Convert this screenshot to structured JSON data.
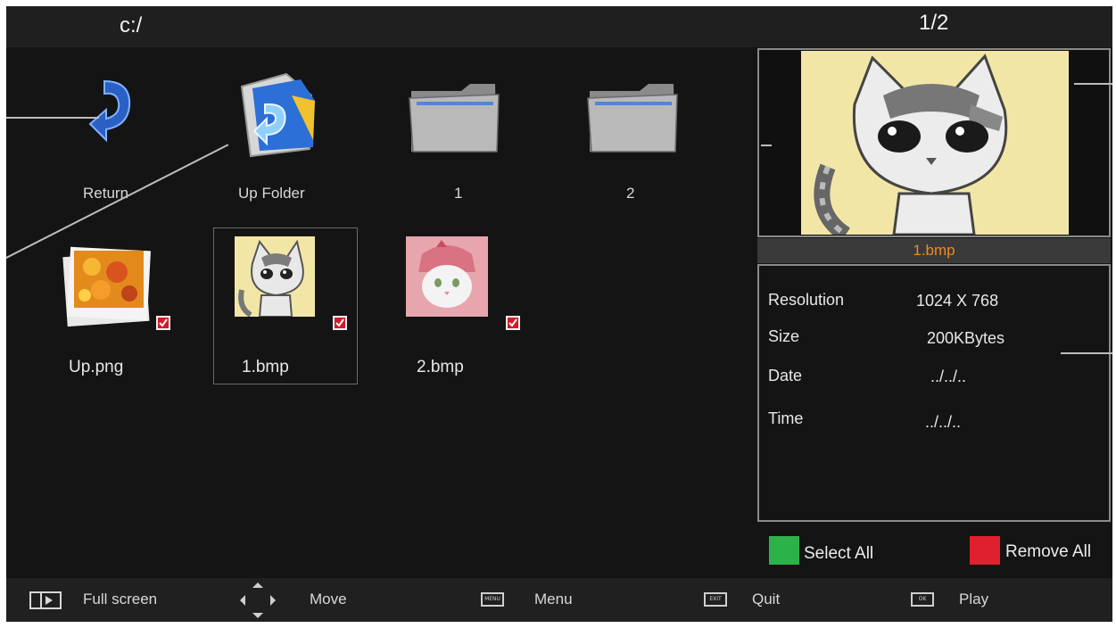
{
  "header": {
    "path": "c:/",
    "page_indicator": "1/2"
  },
  "grid": {
    "items": [
      {
        "label": "Return",
        "icon": "return-arrow-icon"
      },
      {
        "label": "Up Folder",
        "icon": "up-folder-icon"
      },
      {
        "label": "1",
        "icon": "folder-icon"
      },
      {
        "label": "2",
        "icon": "folder-icon"
      },
      {
        "label": "Up.png",
        "icon": "photo-stack-icon",
        "checked": true
      },
      {
        "label": "1.bmp",
        "icon": "cat-thumbnail",
        "checked": true,
        "selected": true
      },
      {
        "label": "2.bmp",
        "icon": "cat-thumbnail-pink",
        "checked": true
      }
    ]
  },
  "preview": {
    "filename": "1.bmp",
    "filename_color": "#f08a1c"
  },
  "info": {
    "resolution_label": "Resolution",
    "resolution_value": "1024 X 768",
    "size_label": "Size",
    "size_value": "200KBytes",
    "date_label": "Date",
    "date_value": "../../..",
    "time_label": "Time",
    "time_value": "../../.."
  },
  "actions": {
    "select_all_label": "Select All",
    "select_all_color": "#2db24a",
    "remove_all_label": "Remove All",
    "remove_all_color": "#e0202e"
  },
  "bottom_bar": {
    "full_screen": "Full screen",
    "move": "Move",
    "menu": "Menu",
    "quit": "Quit",
    "play": "Play",
    "menu_key": "MENU",
    "exit_key": "EXIT",
    "ok_key": "OK"
  }
}
